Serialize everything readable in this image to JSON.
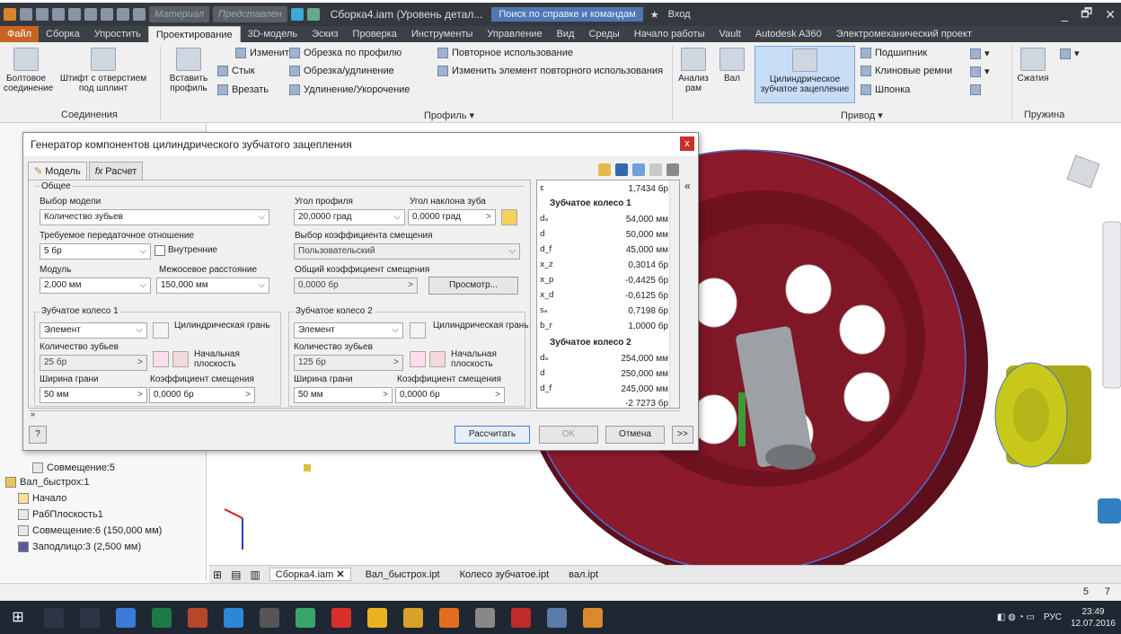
{
  "titlebar": {
    "material": "Материал",
    "appearance": "Представлен",
    "doc_title": "Сборка4.iam (Уровень детал...",
    "search": "Поиск по справке и командам",
    "signin": "Вход",
    "controls": [
      "_",
      "🗗",
      "✕"
    ]
  },
  "ribbon_tabs": [
    "Файл",
    "Сборка",
    "Упростить",
    "Проектирование",
    "3D-модель",
    "Эскиз",
    "Проверка",
    "Инструменты",
    "Управление",
    "Вид",
    "Среды",
    "Начало работы",
    "Vault",
    "Autodesk A360",
    "Электромеханический проект"
  ],
  "ribbon": {
    "bolt": "Болтовое соединение",
    "pin": "Штифт с отверстием под шплинт",
    "panel_joints": "Соединения",
    "insert_profile": "Вставить профиль",
    "butt": "Стык",
    "cut": "Врезать",
    "change": "Изменить",
    "trim_profile": "Обрезка по профилю",
    "trim_extend": "Обрезка/удлинение",
    "lengthen": "Удлинение/Укорочение",
    "reuse": "Повторное использование",
    "change_reuse": "Изменить элемент повторного использования",
    "panel_profile": "Профиль ▾",
    "frame_analysis": "Анализ рам",
    "shaft": "Вал",
    "spur_gear": "Цилиндрическое зубчатое зацепление",
    "bearing": "Подшипник",
    "vbelts": "Клиновые ремни",
    "key": "Шпонка",
    "panel_drive": "Привод ▾",
    "compression": "Сжатия",
    "panel_spring": "Пружина"
  },
  "browser": {
    "items": [
      "Совмещение:5",
      "Вал_быстрох:1",
      "Начало",
      "РабПлоскость1",
      "Совмещение:6 (150,000 мм)",
      "Заподлицо:3 (2,500 мм)"
    ]
  },
  "dialog": {
    "title": "Генератор компонентов цилиндрического зубчатого зацепления",
    "close": "x",
    "tab_model": "Модель",
    "tab_calc": "Расчет",
    "general": "Общее",
    "model_select_label": "Выбор модели",
    "model_select": "Количество зубьев",
    "ratio_label": "Требуемое передаточное отношение",
    "ratio": "5 бр",
    "internal": "Внутренние",
    "module_label": "Модуль",
    "module": "2,000 мм",
    "center_label": "Межосевое расстояние",
    "center": "150,000 мм",
    "pressure_label": "Угол профиля",
    "pressure": "20,0000 град",
    "helix_label": "Угол наклона зуба",
    "helix": "0,0000 град",
    "shift_select_label": "Выбор коэффициента смещения",
    "shift_select": "Пользовательский",
    "total_shift_label": "Общий коэффициент смещения",
    "total_shift": "0,0000 бр",
    "preview": "Просмотр...",
    "gear1": {
      "title": "Зубчатое колесо 1",
      "type": "Элемент",
      "face": "Цилиндрическая грань",
      "teeth_label": "Количество зубьев",
      "teeth": "25 бр",
      "start_plane": "Начальная плоскость",
      "width_label": "Ширина грани",
      "width": "50 мм",
      "shift_label": "Коэффициент смещения",
      "shift": "0,0000 бр"
    },
    "gear2": {
      "title": "Зубчатое колесо 2",
      "type": "Элемент",
      "face": "Цилиндрическая грань",
      "teeth_label": "Количество зубьев",
      "teeth": "125 бр",
      "start_plane": "Начальная плоскость",
      "width_label": "Ширина грани",
      "width": "50 мм",
      "shift_label": "Коэффициент смещения",
      "shift": "0,0000 бр"
    },
    "results": {
      "eps": {
        "sym": "ε",
        "val": "1,7434 бр"
      },
      "g1_title": "Зубчатое колесо 1",
      "g1": [
        {
          "sym": "dₐ",
          "val": "54,000 мм"
        },
        {
          "sym": "d",
          "val": "50,000 мм"
        },
        {
          "sym": "d_f",
          "val": "45,000 мм"
        },
        {
          "sym": "x_z",
          "val": "0,3014 бр"
        },
        {
          "sym": "x_p",
          "val": "-0,4425 бр"
        },
        {
          "sym": "x_d",
          "val": "-0,6125 бр"
        },
        {
          "sym": "sₐ",
          "val": "0,7198 бр"
        },
        {
          "sym": "b_r",
          "val": "1,0000 бр"
        }
      ],
      "g2_title": "Зубчатое колесо 2",
      "g2": [
        {
          "sym": "dₐ",
          "val": "254,000 мм"
        },
        {
          "sym": "d",
          "val": "250,000 мм"
        },
        {
          "sym": "d_f",
          "val": "245,000 мм"
        }
      ],
      "partial": "-2 7273 бр"
    },
    "calculate": "Рассчитать",
    "ok": "OK",
    "cancel": "Отмена",
    "more": ">>",
    "help": "?"
  },
  "doc_tabs": [
    "Сборка4.iam",
    "Вал_быстрох.ipt",
    "Колесо зубчатое.ipt",
    "вал.ipt"
  ],
  "status": {
    "n1": "5",
    "n2": "7"
  },
  "clock": {
    "time": "23:49",
    "date": "12.07.2016",
    "lang": "РУС"
  },
  "colors": {
    "gear": "#8b1a2a",
    "gear_dark": "#5e0f1c",
    "shaft": "#9da0a4",
    "pinion": "#c8c81a",
    "ribbon_active": "#c7dcf5",
    "file_tab": "#c86423"
  }
}
